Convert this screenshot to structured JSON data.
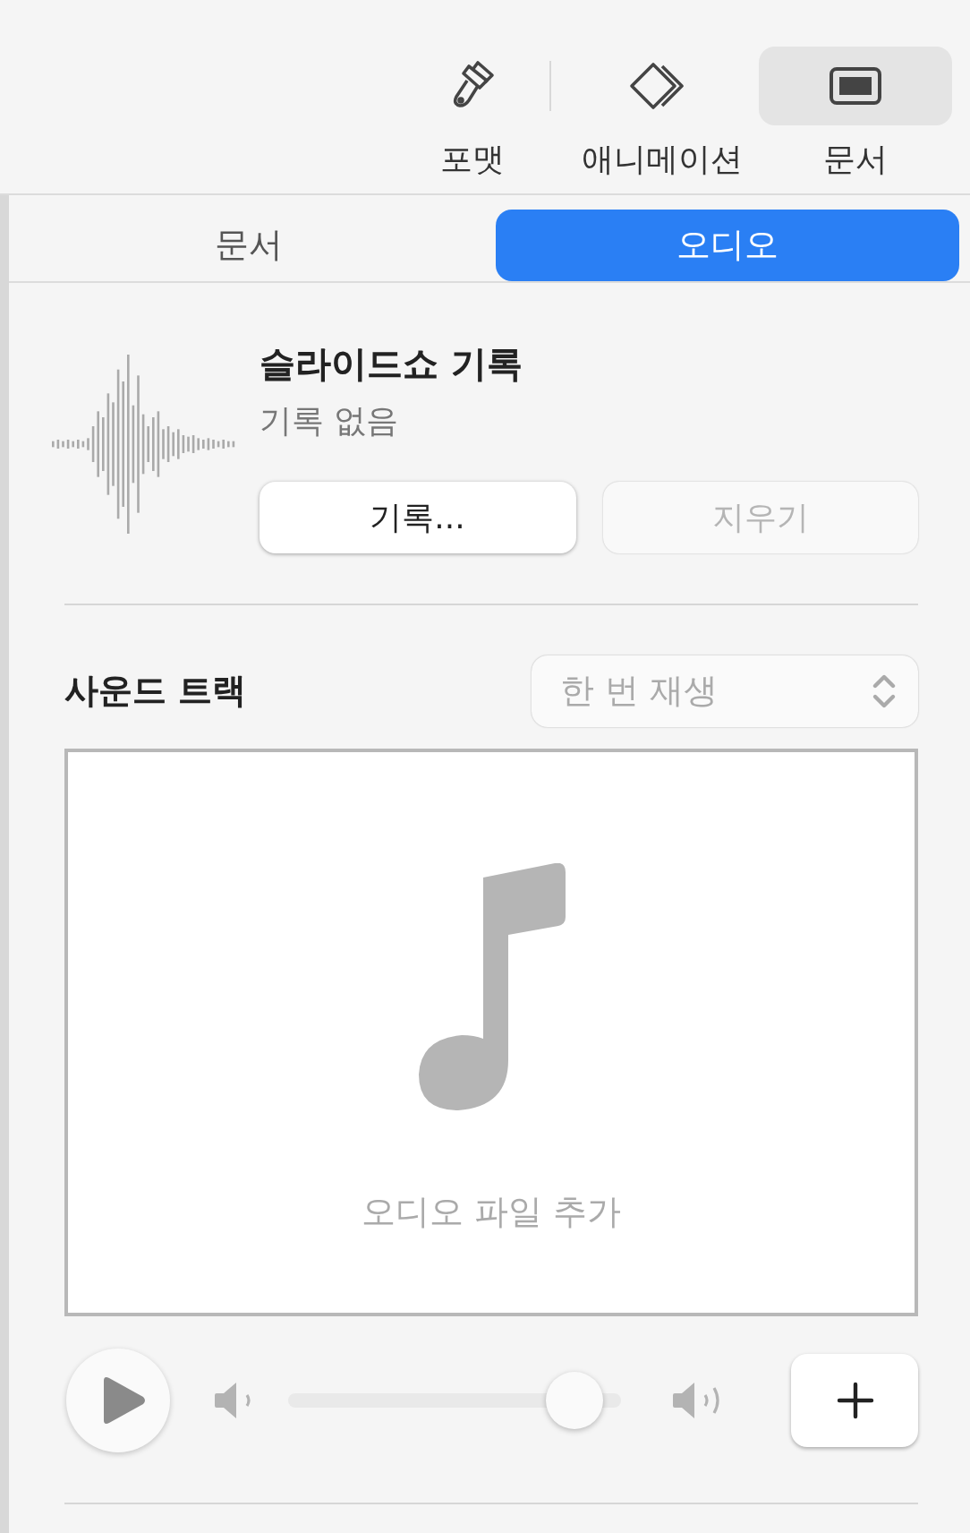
{
  "toolbar": [
    {
      "kind": "format",
      "label": "포맷",
      "selected": false
    },
    {
      "kind": "animate",
      "label": "애니메이션",
      "selected": false
    },
    {
      "kind": "document",
      "label": "문서",
      "selected": true
    }
  ],
  "tabs": [
    {
      "label": "문서",
      "selected": false
    },
    {
      "label": "오디오",
      "selected": true
    }
  ],
  "recording": {
    "title": "슬라이드쇼 기록",
    "status": "기록 없음",
    "buttons": [
      {
        "label": "기록...",
        "disabled": false
      },
      {
        "label": "지우기",
        "disabled": true
      }
    ]
  },
  "soundtrack": {
    "title": "사운드 트랙",
    "mode": "한 번 재생",
    "drop_hint": "오디오 파일 추가",
    "volume": {
      "level": 0.9
    }
  }
}
